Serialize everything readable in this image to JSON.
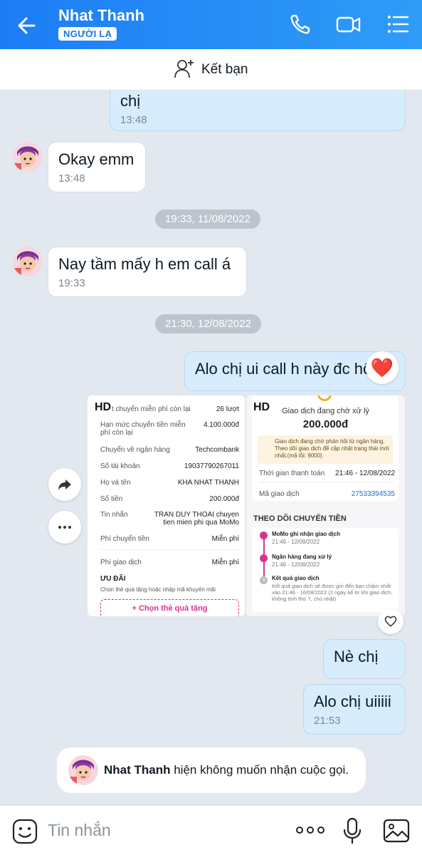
{
  "header": {
    "name": "Nhat Thanh",
    "badge": "NGƯỜI LẠ"
  },
  "add_friend": {
    "label": "Kết bạn"
  },
  "messages": [
    {
      "side": "out",
      "text": "chị",
      "time": "13:48"
    },
    {
      "side": "in",
      "text": "Okay emm",
      "time": "13:48"
    },
    {
      "side": "in",
      "text": "Nay tầm mấy h em call á",
      "time": "19:33"
    },
    {
      "side": "out",
      "text": "Alo chị ui call h này đc hôg"
    },
    {
      "side": "out",
      "text": "Nè chị"
    },
    {
      "side": "out",
      "text": "Alo chị uiiiii",
      "time": "21:53"
    }
  ],
  "date_chips": [
    "19:33, 11/08/2022",
    "21:30, 12/08/2022"
  ],
  "reaction": "❤️",
  "photo_left": {
    "hd": "HD",
    "rows": [
      {
        "k": "t chuyển miễn phí còn lại",
        "v": "26 lượt"
      },
      {
        "k": "Hạn mức chuyển tiền miễn phí còn lại",
        "v": "4.100.000đ"
      },
      {
        "k": "Chuyển về ngân hàng",
        "v": "Techcombank"
      },
      {
        "k": "Số tài khoản",
        "v": "19037790267011"
      },
      {
        "k": "Họ và tên",
        "v": "KHA NHAT THANH"
      },
      {
        "k": "Số tiền",
        "v": "200.000đ"
      },
      {
        "k": "Tin nhắn",
        "v": "TRAN DUY THOAI chuyen tien mien phi qua MoMo"
      },
      {
        "k": "Phí chuyển tiền",
        "v": "Miễn phí"
      },
      {
        "k": "Phí giao dịch",
        "v": "Miễn phí"
      }
    ],
    "promo_title": "ƯU ĐÃI",
    "promo_sub": "Chọn thẻ quà tặng hoặc nhập mã khuyến mãi",
    "promo_btn": "Chọn thẻ quà tặng"
  },
  "photo_right": {
    "hd": "HD",
    "status": "Giao dịch đang chờ xử lý",
    "amount": "200.000đ",
    "note": "Giao dịch đang chờ phản hồi từ ngân hàng. Theo dõi giao dịch để cập nhật trạng thái mới nhất.(mã lỗi: 9000).",
    "time_label": "Thời gian thanh toán",
    "time_value": "21:46 - 12/08/2022",
    "code_label": "Mã giao dịch",
    "code_value": "27533394535",
    "track_title": "THEO DÕI CHUYỂN TIỀN",
    "steps": [
      {
        "title": "MoMo ghi nhận giao dịch",
        "sub": "21:46 - 12/08/2022"
      },
      {
        "title": "Ngân hàng đang xử lý",
        "sub": "21:46 - 12/08/2022"
      },
      {
        "title": "Kết quả giao dịch",
        "sub": "Kết quả giao dịch sẽ được gửi đến bạn chậm nhất vào 21:46 - 16/08/2022 (2 ngày kể từ khi giao dịch, không tính thứ 7, chủ nhật)"
      }
    ],
    "step3_num": "3"
  },
  "system_message": {
    "name": "Nhat Thanh",
    "text": " hiện không muốn nhận cuộc gọi."
  },
  "input": {
    "placeholder": "Tin nhắn"
  },
  "colors": {
    "header_start": "#1c7df5",
    "header_end": "#2f9cf7",
    "out_bubble": "#d7ecfd",
    "accent_pink": "#d6338f"
  }
}
